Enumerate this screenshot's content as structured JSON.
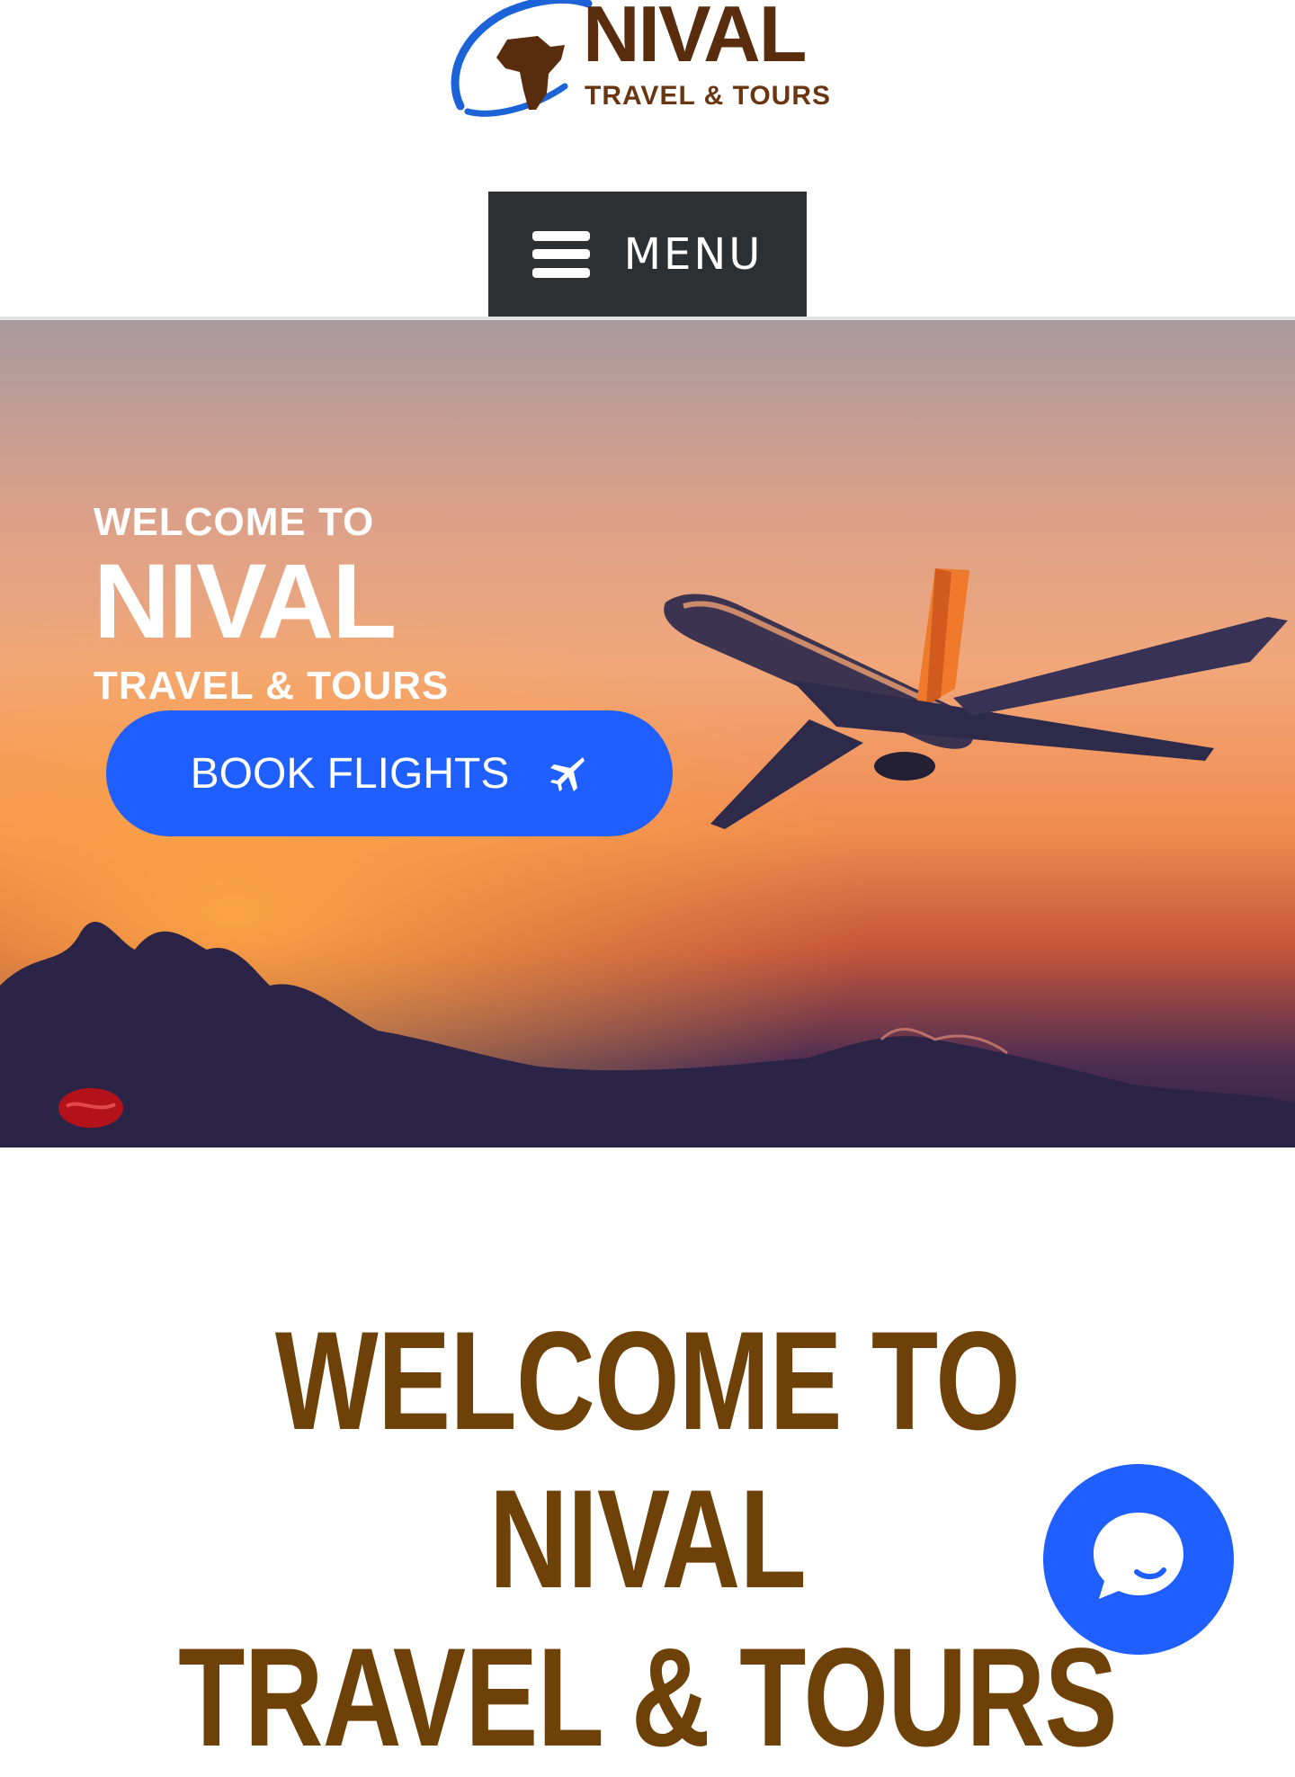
{
  "logo": {
    "word": "NIVAL",
    "tagline": "TRAVEL & TOURS"
  },
  "menu": {
    "label": "MENU",
    "icon": "hamburger-icon"
  },
  "hero": {
    "welcome": "WELCOME TO",
    "brand": "NIVAL",
    "subtitle": "TRAVEL & TOURS",
    "cta_label": "BOOK FLIGHTS",
    "cta_icon": "airplane-icon"
  },
  "welcome_section": {
    "line1": "WELCOME TO NIVAL",
    "line2": "TRAVEL & TOURS"
  },
  "chat": {
    "icon": "chat-bubble-icon"
  },
  "colors": {
    "brand_brown": "#6e4108",
    "accent_blue": "#1f5fff",
    "menu_bg": "#2d3033"
  }
}
